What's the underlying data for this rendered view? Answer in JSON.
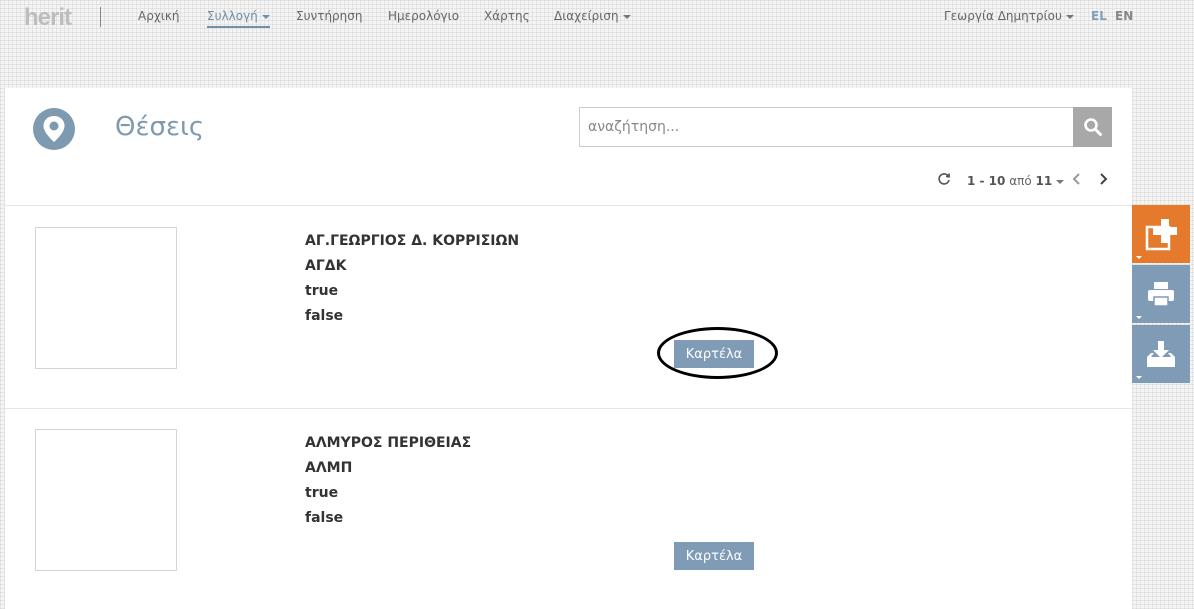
{
  "navbar": {
    "logo": "herit",
    "items": [
      {
        "label": "Αρχική"
      },
      {
        "label": "Συλλογή"
      },
      {
        "label": "Συντήρηση"
      },
      {
        "label": "Ημερολόγιο"
      },
      {
        "label": "Χάρτης"
      },
      {
        "label": "Διαχείριση"
      }
    ],
    "user": "Γεωργία Δημητρίου",
    "languages": [
      "EL",
      "EN"
    ]
  },
  "page": {
    "title": "Θέσεις",
    "search_placeholder": "αναζήτηση...",
    "pager": {
      "range": "1 - 10",
      "of_label": "από",
      "total": "11"
    }
  },
  "records": [
    {
      "name": "ΑΓ.ΓΕΩΡΓΙΟΣ Δ. ΚΟΡΡΙΣΙΩΝ",
      "code": "ΑΓΔΚ",
      "flag1": "true",
      "flag2": "false",
      "button_label": "Καρτέλα"
    },
    {
      "name": "ΑΛΜΥΡΟΣ ΠΕΡΙΘΕΙΑΣ",
      "code": "ΑΛΜΠ",
      "flag1": "true",
      "flag2": "false",
      "button_label": "Καρτέλα"
    }
  ],
  "colors": {
    "accent": "#7f9bb5",
    "add_button": "#e57a2c",
    "title": "#7d9ab1"
  },
  "icons": {
    "title": "map-pin-icon",
    "search": "search-icon",
    "refresh": "refresh-icon",
    "side_add": "add-icon",
    "side_print": "print-icon",
    "side_download": "download-icon"
  }
}
